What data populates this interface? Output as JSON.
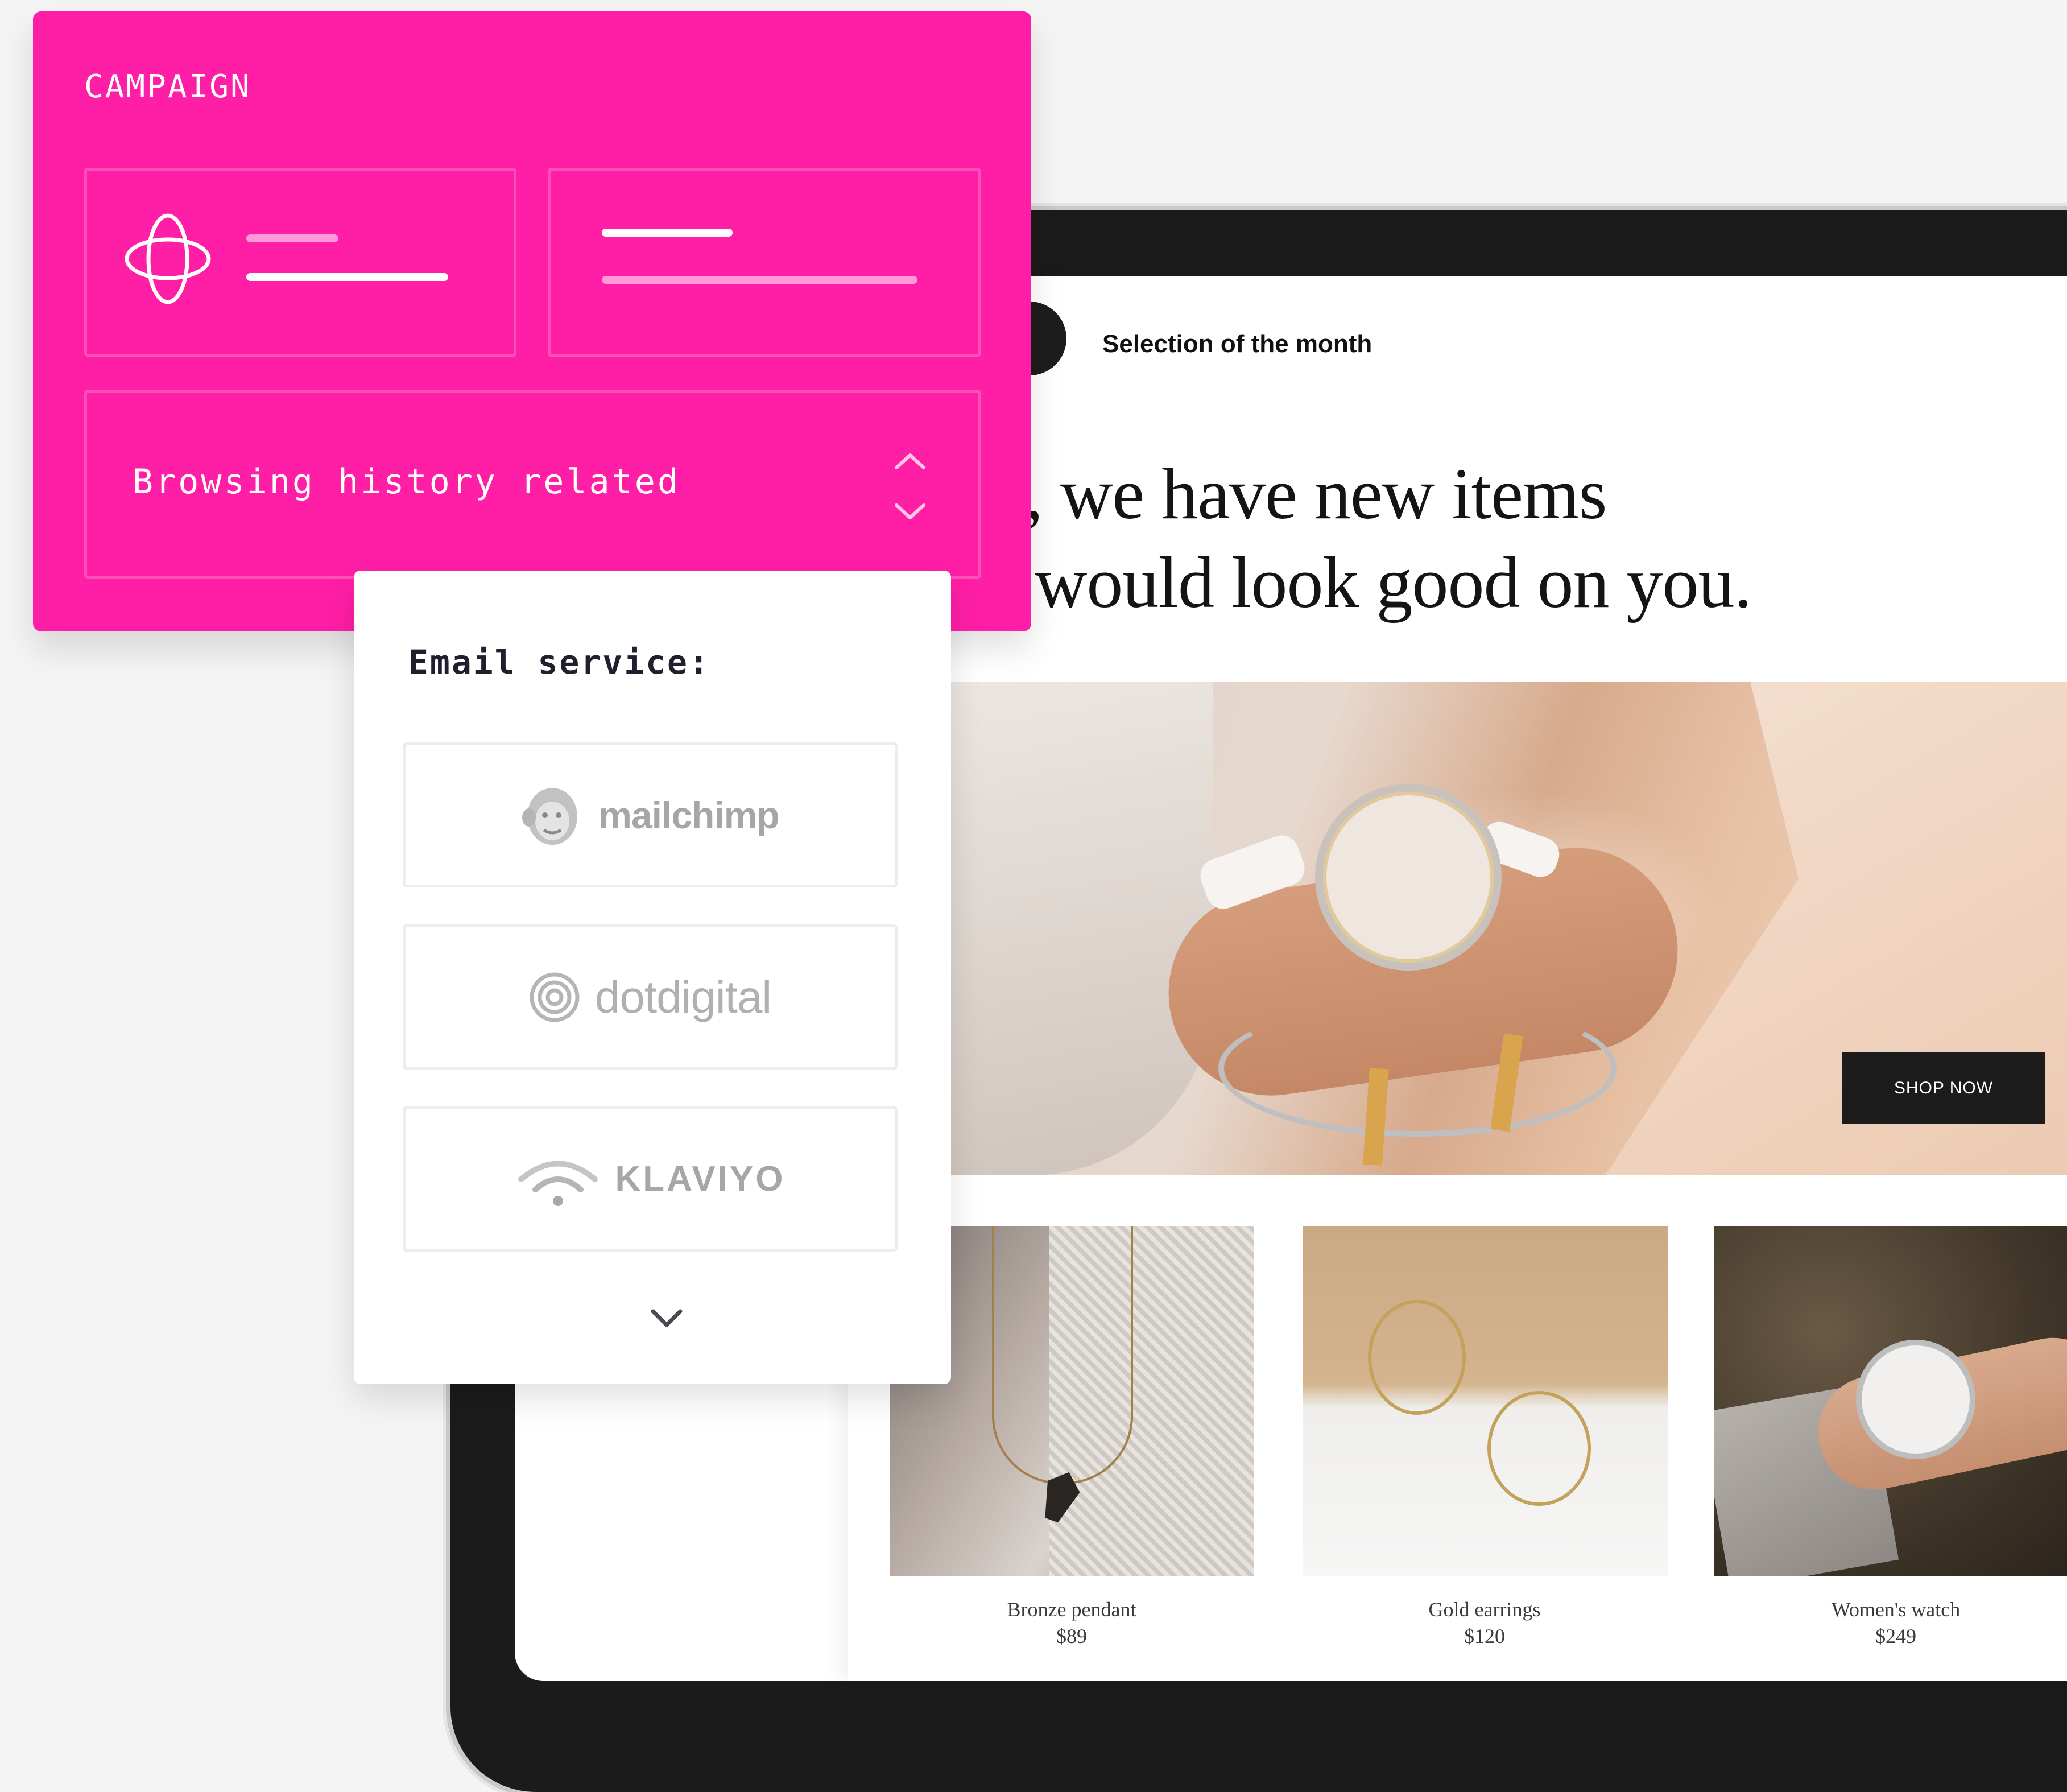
{
  "campaign": {
    "title": "CAMPAIGN",
    "targeting_option": "Browsing history related",
    "accent_color": "#ff1ea6",
    "icons": [
      "orbit-icon",
      "chevron-up-icon",
      "chevron-down-icon"
    ]
  },
  "email_service": {
    "title": "Email service:",
    "providers": [
      {
        "name": "mailchimp",
        "icon": "mailchimp-logo-icon"
      },
      {
        "name": "dotdigital",
        "icon": "dotdigital-logo-icon"
      },
      {
        "name": "KLAVIYO",
        "icon": "klaviyo-logo-icon"
      }
    ],
    "more_icon": "chevron-down-icon"
  },
  "email_preview": {
    "section_label": "Selection of the month",
    "headline_line1": "Hey, we have new items",
    "headline_line2": "that would look good on you.",
    "cta_label": "SHOP NOW",
    "products": [
      {
        "name": "Bronze pendant",
        "price": "$89"
      },
      {
        "name": "Gold earrings",
        "price": "$120"
      },
      {
        "name": "Women's watch",
        "price": "$249"
      }
    ]
  }
}
